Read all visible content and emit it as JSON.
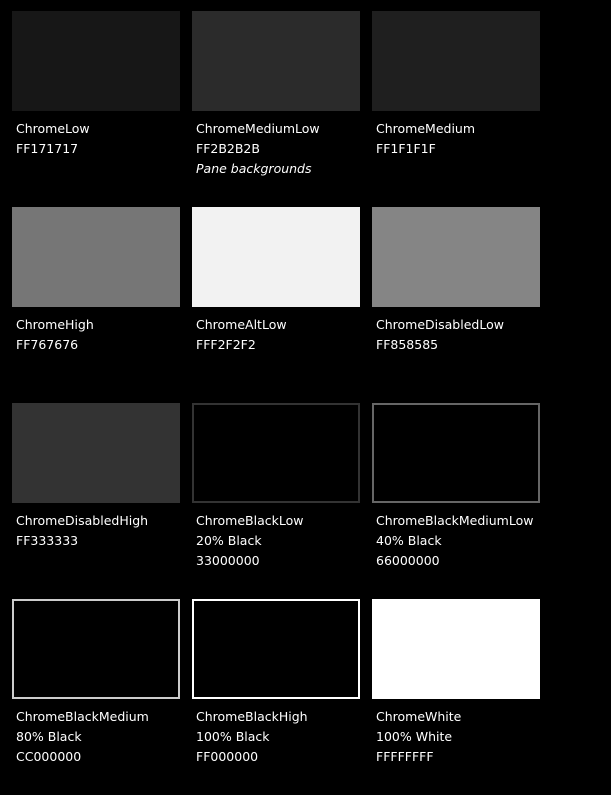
{
  "swatches": [
    {
      "name": "ChromeLow",
      "lines": [
        "FF171717"
      ],
      "fill": "#171717",
      "border": ""
    },
    {
      "name": "ChromeMediumLow",
      "lines": [
        "FF2B2B2B"
      ],
      "note": "Pane backgrounds",
      "fill": "#2B2B2B",
      "border": ""
    },
    {
      "name": "ChromeMedium",
      "lines": [
        "FF1F1F1F"
      ],
      "fill": "#1F1F1F",
      "border": ""
    },
    {
      "name": "ChromeHigh",
      "lines": [
        "FF767676"
      ],
      "fill": "#767676",
      "border": ""
    },
    {
      "name": "ChromeAltLow",
      "lines": [
        "FFF2F2F2"
      ],
      "fill": "#F2F2F2",
      "border": ""
    },
    {
      "name": "ChromeDisabledLow",
      "lines": [
        "FF858585"
      ],
      "fill": "#858585",
      "border": ""
    },
    {
      "name": "ChromeDisabledHigh",
      "lines": [
        "FF333333"
      ],
      "fill": "#333333",
      "border": ""
    },
    {
      "name": "ChromeBlackLow",
      "lines": [
        "20% Black",
        "33000000"
      ],
      "fill": "#000000",
      "border": "#333333"
    },
    {
      "name": "ChromeBlackMediumLow",
      "lines": [
        "40% Black",
        "66000000"
      ],
      "fill": "#000000",
      "border": "#666666"
    },
    {
      "name": "ChromeBlackMedium",
      "lines": [
        "80% Black",
        "CC000000"
      ],
      "fill": "#000000",
      "border": "#CCCCCC"
    },
    {
      "name": "ChromeBlackHigh",
      "lines": [
        "100% Black",
        "FF000000"
      ],
      "fill": "#000000",
      "border": "#FFFFFF"
    },
    {
      "name": "ChromeWhite",
      "lines": [
        "100% White",
        "FFFFFFFF"
      ],
      "fill": "#FFFFFF",
      "border": ""
    }
  ]
}
